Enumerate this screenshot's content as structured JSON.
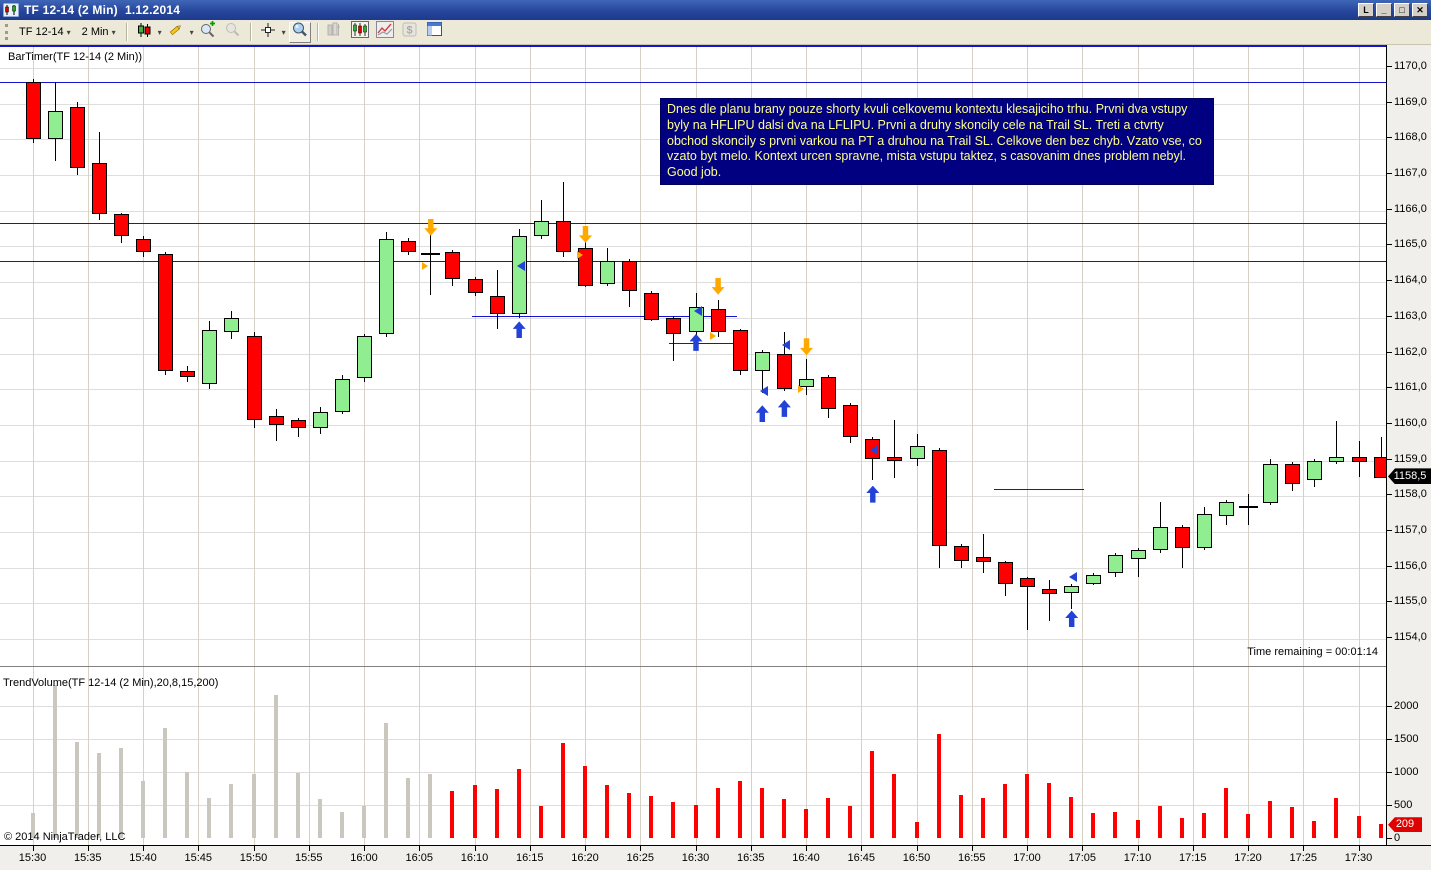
{
  "window": {
    "title": "TF 12-14 (2 Min)  1.12.2014",
    "controls": [
      "L",
      "_",
      "□",
      "✕"
    ]
  },
  "toolbar": {
    "instrument": "TF 12-14",
    "interval": "2 Min",
    "dropdown_caret": "▾",
    "icons": [
      {
        "name": "chart-style-button",
        "icon": "candlestick-icon",
        "dropdown": true
      },
      {
        "name": "drawing-tools-button",
        "icon": "pencil-icon",
        "dropdown": true
      },
      {
        "name": "zoom-in-button",
        "icon": "zoom-in-icon"
      },
      {
        "name": "zoom-out-button",
        "icon": "zoom-out-icon",
        "disabled": true
      },
      {
        "name": "cursor-button",
        "icon": "crosshair-icon",
        "dropdown": true
      },
      {
        "name": "data-box-button",
        "icon": "magnifier-icon"
      },
      {
        "name": "chart-trader-button",
        "icon": "chart-trader-icon",
        "disabled": true
      },
      {
        "name": "bars-panel-button",
        "icon": "mini-candles-icon"
      },
      {
        "name": "indicators-button",
        "icon": "line-chart-icon"
      },
      {
        "name": "account-button",
        "icon": "dollar-icon",
        "disabled": true
      },
      {
        "name": "properties-button",
        "icon": "properties-icon"
      }
    ]
  },
  "chart": {
    "indicator_label": "BarTimer(TF 12-14 (2 Min))",
    "volume_label": "TrendVolume(TF 12-14 (2 Min),20,8,15,200)",
    "time_remaining": "Time remaining = 00:01:14",
    "copyright": "© 2014 NinjaTrader, LLC",
    "note": "Dnes dle planu brany pouze shorty kvuli celkovemu kontextu klesajiciho trhu. Prvni dva vstupy byly na HFLIPU dalsi dva na LFLIPU. Prvni a druhy skoncily cele na Trail SL. Treti a ctvrty obchod skoncily s prvni varkou na PT a druhou na Trail SL. Celkove den bez chyb. Vzato vse, co vzato byt melo. Kontext urcen spravne, mista vstupu taktez, s casovanim dnes problem nebyl. Good job."
  },
  "chart_data": {
    "type": "candlestick+volume",
    "instrument": "TF 12-14",
    "interval": "2 Min",
    "date": "1.12.2014",
    "price_axis": {
      "max": 1170.0,
      "min": 1154.0,
      "step": 1.0,
      "labels": [
        "1170,0",
        "1169,0",
        "1168,0",
        "1167,0",
        "1166,0",
        "1165,0",
        "1164,0",
        "1163,0",
        "1162,0",
        "1161,0",
        "1160,0",
        "1159,0",
        "1158,0",
        "1157,0",
        "1156,0",
        "1155,0",
        "1154,0"
      ]
    },
    "volume_axis": {
      "ticks": [
        {
          "v": 2000,
          "label": "2000"
        },
        {
          "v": 1500,
          "label": "1500"
        },
        {
          "v": 1000,
          "label": "1000"
        },
        {
          "v": 500,
          "label": "500"
        },
        {
          "v": 0,
          "label": "0"
        }
      ]
    },
    "time_ticks": [
      "15:30",
      "15:35",
      "15:40",
      "15:45",
      "15:50",
      "15:55",
      "16:00",
      "16:05",
      "16:10",
      "16:15",
      "16:20",
      "16:25",
      "16:30",
      "16:35",
      "16:40",
      "16:45",
      "16:50",
      "16:55",
      "17:00",
      "17:05",
      "17:10",
      "17:15",
      "17:20",
      "17:25",
      "17:30"
    ],
    "price_badge": {
      "label": "1158,5",
      "value": 1158.5
    },
    "volume_badge": {
      "label": "209",
      "value": 209
    },
    "hlines": [
      {
        "price": 1169.6
      },
      {
        "price": 1165.67
      },
      {
        "price": 1164.6
      }
    ],
    "segments": [
      {
        "price": 1163.05,
        "from_bar": 19.9,
        "to_bar": 31.9
      },
      {
        "price": 1162.3,
        "from_bar": 28.8,
        "to_bar": 32.1
      },
      {
        "price": 1158.2,
        "from_bar": 43.5,
        "to_bar": 47.6
      }
    ],
    "markers": [
      {
        "bar": 18,
        "type": "down_arrow_orange",
        "price": 1165.3
      },
      {
        "bar": 18,
        "type": "right_triangle_orange",
        "price": 1164.45
      },
      {
        "bar": 22,
        "type": "left_triangle_blue",
        "price": 1164.45
      },
      {
        "bar": 22,
        "type": "up_arrow_blue",
        "price": 1162.9
      },
      {
        "bar": 25,
        "type": "down_arrow_orange",
        "price": 1165.1
      },
      {
        "bar": 25,
        "type": "right_triangle_orange",
        "price": 1164.75
      },
      {
        "bar": 30,
        "type": "left_triangle_blue",
        "price": 1163.2
      },
      {
        "bar": 30,
        "type": "up_arrow_blue",
        "price": 1162.55
      },
      {
        "bar": 31,
        "type": "down_arrow_orange",
        "price": 1163.65
      },
      {
        "bar": 31,
        "type": "right_triangle_orange",
        "price": 1162.5
      },
      {
        "bar": 33,
        "type": "left_triangle_blue",
        "price": 1160.95
      },
      {
        "bar": 33,
        "type": "up_arrow_blue",
        "price": 1160.55
      },
      {
        "bar": 34,
        "type": "left_triangle_blue",
        "price": 1162.25
      },
      {
        "bar": 34,
        "type": "up_arrow_blue",
        "price": 1160.7
      },
      {
        "bar": 35,
        "type": "down_arrow_orange",
        "price": 1161.95
      },
      {
        "bar": 35,
        "type": "right_triangle_orange",
        "price": 1161.0
      },
      {
        "bar": 38,
        "type": "left_triangle_blue",
        "price": 1159.3
      },
      {
        "bar": 38,
        "type": "up_arrow_blue",
        "price": 1158.3
      },
      {
        "bar": 47,
        "type": "left_triangle_blue",
        "price": 1155.75
      },
      {
        "bar": 47,
        "type": "up_arrow_blue",
        "price": 1154.8
      }
    ],
    "bars": [
      [
        "15:30",
        1169.6,
        1169.7,
        1167.9,
        1168.0,
        380,
        "g"
      ],
      [
        "15:32",
        1168.0,
        1169.6,
        1167.4,
        1168.8,
        2325,
        "g"
      ],
      [
        "15:34",
        1168.9,
        1169.05,
        1167.0,
        1167.2,
        1460,
        "g"
      ],
      [
        "15:36",
        1167.35,
        1168.2,
        1165.75,
        1165.9,
        1290,
        "g"
      ],
      [
        "15:38",
        1165.9,
        1165.95,
        1165.1,
        1165.3,
        1370,
        "g"
      ],
      [
        "15:40",
        1165.2,
        1165.3,
        1164.7,
        1164.85,
        870,
        "g"
      ],
      [
        "15:42",
        1164.8,
        1164.85,
        1161.4,
        1161.5,
        1670,
        "g"
      ],
      [
        "15:44",
        1161.5,
        1161.65,
        1161.2,
        1161.35,
        1000,
        "g"
      ],
      [
        "15:46",
        1161.15,
        1162.9,
        1161.0,
        1162.65,
        610,
        "g"
      ],
      [
        "15:48",
        1162.6,
        1163.2,
        1162.4,
        1163.0,
        820,
        "g"
      ],
      [
        "15:50",
        1162.5,
        1162.6,
        1159.9,
        1160.15,
        975,
        "g"
      ],
      [
        "15:52",
        1160.25,
        1160.45,
        1159.55,
        1160.0,
        2175,
        "g"
      ],
      [
        "15:54",
        1160.15,
        1160.2,
        1159.65,
        1159.9,
        990,
        "g"
      ],
      [
        "15:56",
        1159.9,
        1160.5,
        1159.75,
        1160.35,
        595,
        "g"
      ],
      [
        "15:58",
        1160.35,
        1161.4,
        1160.3,
        1161.3,
        395,
        "g"
      ],
      [
        "16:00",
        1161.3,
        1162.55,
        1161.2,
        1162.5,
        490,
        "g"
      ],
      [
        "16:02",
        1162.55,
        1165.4,
        1162.45,
        1165.2,
        1745,
        "g"
      ],
      [
        "16:04",
        1165.15,
        1165.25,
        1164.75,
        1164.85,
        910,
        "g"
      ],
      [
        "16:06",
        1164.8,
        1165.4,
        1163.65,
        1164.8,
        970,
        "g"
      ],
      [
        "16:08",
        1164.85,
        1164.9,
        1163.9,
        1164.1,
        715,
        "r"
      ],
      [
        "16:10",
        1164.1,
        1164.15,
        1163.6,
        1163.7,
        800,
        "r"
      ],
      [
        "16:12",
        1163.6,
        1164.35,
        1162.7,
        1163.1,
        740,
        "r"
      ],
      [
        "16:14",
        1163.1,
        1165.5,
        1163.0,
        1165.3,
        1050,
        "r"
      ],
      [
        "16:16",
        1165.3,
        1166.3,
        1165.2,
        1165.7,
        480,
        "r"
      ],
      [
        "16:18",
        1165.7,
        1166.8,
        1164.7,
        1164.85,
        1450,
        "r"
      ],
      [
        "16:20",
        1164.95,
        1165.25,
        1163.85,
        1163.9,
        1100,
        "r"
      ],
      [
        "16:22",
        1163.95,
        1164.95,
        1163.9,
        1164.6,
        800,
        "r"
      ],
      [
        "16:24",
        1164.6,
        1164.65,
        1163.3,
        1163.75,
        690,
        "r"
      ],
      [
        "16:26",
        1163.7,
        1163.75,
        1162.9,
        1162.95,
        640,
        "r"
      ],
      [
        "16:28",
        1163.0,
        1163.05,
        1161.8,
        1162.55,
        540,
        "r"
      ],
      [
        "16:30",
        1162.6,
        1163.7,
        1162.5,
        1163.3,
        500,
        "r"
      ],
      [
        "16:32",
        1163.25,
        1163.5,
        1162.45,
        1162.6,
        760,
        "r"
      ],
      [
        "16:34",
        1162.65,
        1162.7,
        1161.4,
        1161.5,
        870,
        "r"
      ],
      [
        "16:36",
        1161.5,
        1162.1,
        1160.9,
        1162.05,
        760,
        "r"
      ],
      [
        "16:38",
        1162.0,
        1162.6,
        1160.95,
        1161.0,
        590,
        "r"
      ],
      [
        "16:40",
        1161.05,
        1161.85,
        1160.85,
        1161.3,
        440,
        "r"
      ],
      [
        "16:42",
        1161.35,
        1161.4,
        1160.2,
        1160.45,
        610,
        "r"
      ],
      [
        "16:44",
        1160.55,
        1160.6,
        1159.5,
        1159.65,
        490,
        "r"
      ],
      [
        "16:46",
        1159.6,
        1159.65,
        1158.45,
        1159.05,
        1320,
        "r"
      ],
      [
        "16:48",
        1159.1,
        1160.15,
        1158.5,
        1159.0,
        975,
        "r"
      ],
      [
        "16:50",
        1159.05,
        1159.75,
        1158.85,
        1159.4,
        245,
        "r"
      ],
      [
        "16:52",
        1159.3,
        1159.35,
        1156.0,
        1156.6,
        1580,
        "r"
      ],
      [
        "16:54",
        1156.6,
        1156.65,
        1156.0,
        1156.2,
        655,
        "r"
      ],
      [
        "16:56",
        1156.3,
        1156.95,
        1155.85,
        1156.15,
        610,
        "r"
      ],
      [
        "16:58",
        1156.15,
        1156.2,
        1155.2,
        1155.55,
        820,
        "r"
      ],
      [
        "17:00",
        1155.7,
        1155.75,
        1154.25,
        1155.45,
        975,
        "r"
      ],
      [
        "17:02",
        1155.4,
        1155.65,
        1154.5,
        1155.25,
        835,
        "r"
      ],
      [
        "17:04",
        1155.3,
        1155.55,
        1154.85,
        1155.5,
        620,
        "r"
      ],
      [
        "17:06",
        1155.55,
        1155.85,
        1155.5,
        1155.8,
        380,
        "r"
      ],
      [
        "17:08",
        1155.85,
        1156.4,
        1155.75,
        1156.35,
        395,
        "r"
      ],
      [
        "17:10",
        1156.25,
        1156.55,
        1155.75,
        1156.5,
        275,
        "r"
      ],
      [
        "17:12",
        1156.5,
        1157.85,
        1156.4,
        1157.15,
        490,
        "r"
      ],
      [
        "17:14",
        1157.15,
        1157.2,
        1156.0,
        1156.55,
        305,
        "r"
      ],
      [
        "17:16",
        1156.55,
        1157.7,
        1156.5,
        1157.5,
        380,
        "r"
      ],
      [
        "17:18",
        1157.45,
        1157.9,
        1157.2,
        1157.85,
        760,
        "r"
      ],
      [
        "17:20",
        1157.7,
        1158.05,
        1157.2,
        1157.7,
        365,
        "r"
      ],
      [
        "17:22",
        1157.8,
        1159.05,
        1157.75,
        1158.9,
        560,
        "r"
      ],
      [
        "17:24",
        1158.9,
        1158.95,
        1158.15,
        1158.35,
        470,
        "r"
      ],
      [
        "17:26",
        1158.45,
        1159.05,
        1158.25,
        1159.0,
        260,
        "r"
      ],
      [
        "17:28",
        1158.95,
        1160.1,
        1158.9,
        1159.1,
        610,
        "r"
      ],
      [
        "17:30",
        1159.1,
        1159.55,
        1158.55,
        1158.95,
        335,
        "r"
      ],
      [
        "17:32",
        1159.1,
        1159.65,
        1158.5,
        1158.5,
        209,
        "r"
      ]
    ],
    "colors": {
      "candle_up": "#90EE90",
      "candle_down": "#FF0000",
      "candle_border": "#000000",
      "volume_gray": "#C9C7BE",
      "volume_red": "#FF0000",
      "line_blue": "#1414C8",
      "marker_blue": "#2343D7",
      "marker_orange": "#FFA800",
      "note_bg": "#000080",
      "note_text": "#FFFF8C"
    },
    "legend_position": "none",
    "grid": true
  }
}
